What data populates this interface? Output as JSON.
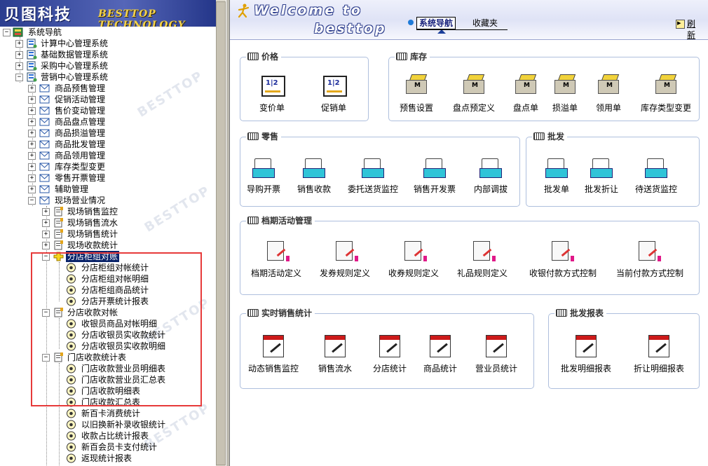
{
  "left_header": {
    "brand_cn": "贝图科技",
    "brand_en": "BESTTOP TECHNOLOGY"
  },
  "tree": {
    "root": "系统导航",
    "systems": [
      "计算中心管理系统",
      "基础数据管理系统",
      "采购中心管理系统",
      "营销中心管理系统"
    ],
    "marketing_modules": [
      "商品预售管理",
      "促销活动管理",
      "售价变动管理",
      "商品盘点管理",
      "商品损溢管理",
      "商品批发管理",
      "商品领用管理",
      "库存类型变更",
      "零售开票管理",
      "辅助管理",
      "现场营业情况"
    ],
    "site_items": [
      "现场销售监控",
      "现场销售流水",
      "现场销售统计",
      "现场收款统计"
    ],
    "folders": [
      {
        "label": "分店柜组对账",
        "children": [
          "分店柜组对帐统计",
          "分店柜组对帐明细",
          "分店柜组商品统计",
          "分店开票统计报表"
        ]
      },
      {
        "label": "分店收款对帐",
        "children": [
          "收银员商品对帐明细",
          "分店收银员实收款统计",
          "分店收银员实收款明细"
        ]
      },
      {
        "label": "门店收款统计表",
        "children": [
          "门店收款营业员明细表",
          "门店收款营业员汇总表",
          "门店收款明细表",
          "门店收款汇总表",
          "新百卡消费统计",
          "以旧换新补录收银统计",
          "收款占比统计报表",
          "新百会员卡支付统计",
          "返现统计报表"
        ]
      }
    ],
    "watermark": "BESTTOP"
  },
  "right_header": {
    "welcome_line1": "Welcome to",
    "welcome_line2": "besttop",
    "tab_nav": "系统导航",
    "tab_fav": "收藏夹",
    "refresh": "刷新"
  },
  "groups": {
    "price": {
      "title": "价格",
      "items": [
        "变价单",
        "促销单"
      ]
    },
    "inventory": {
      "title": "库存",
      "items": [
        "预售设置",
        "盘点预定义",
        "盘点单",
        "损溢单",
        "领用单",
        "库存类型变更"
      ]
    },
    "retail": {
      "title": "零售",
      "items": [
        "导购开票",
        "销售收款",
        "委托送货监控",
        "销售开发票",
        "内部调拔"
      ]
    },
    "wholesale": {
      "title": "批发",
      "items": [
        "批发单",
        "批发折让",
        "待送货监控"
      ]
    },
    "season": {
      "title": "档期活动管理",
      "items": [
        "档期活动定义",
        "发券规则定义",
        "收券规则定义",
        "礼品规则定义",
        "收银付款方式控制",
        "当前付款方式控制"
      ]
    },
    "realtime": {
      "title": "实时销售统计",
      "items": [
        "动态销售监控",
        "销售流水",
        "分店统计",
        "商品统计",
        "营业员统计"
      ]
    },
    "wholesale_report": {
      "title": "批发报表",
      "items": [
        "批发明细报表",
        "折让明细报表"
      ]
    }
  }
}
